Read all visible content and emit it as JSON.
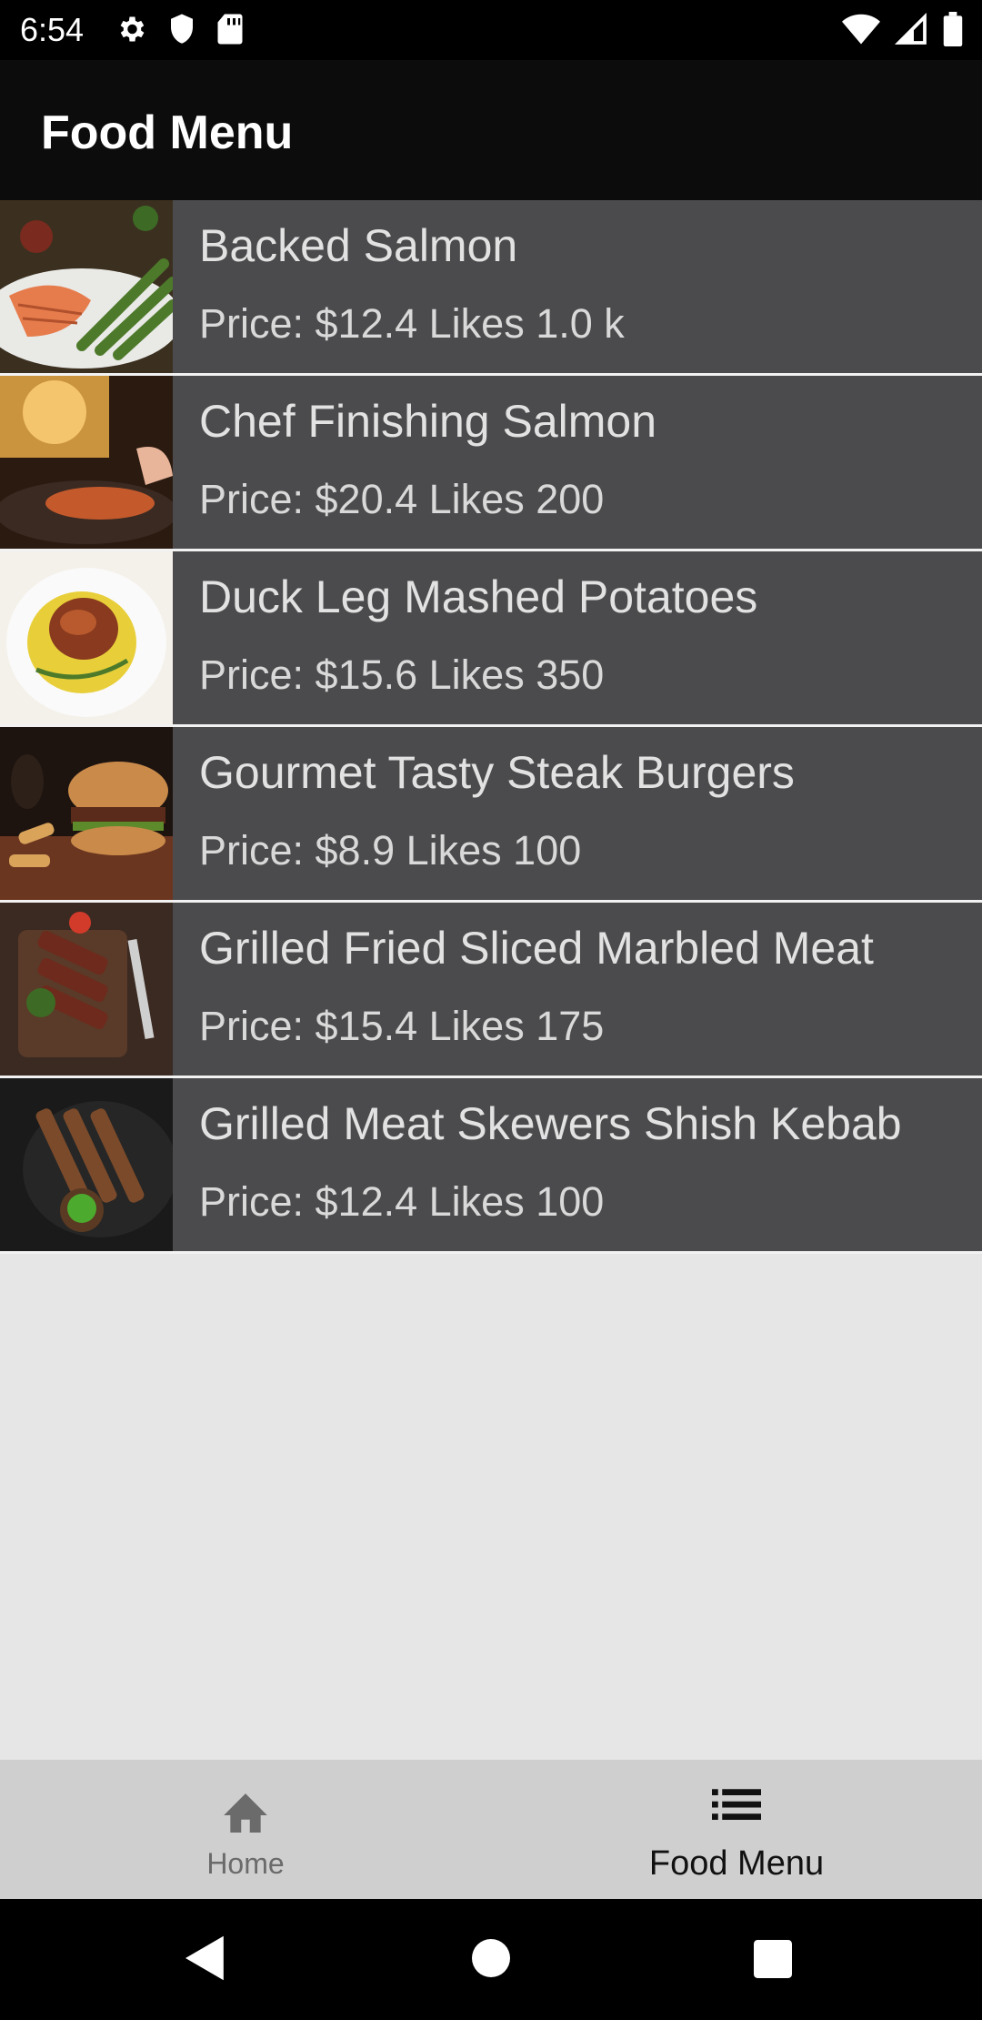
{
  "status_bar": {
    "time": "6:54",
    "left_icons": [
      "gear-icon",
      "shield-icon",
      "sd-card-icon"
    ],
    "right_icons": [
      "wifi-icon",
      "signal-icon",
      "battery-icon"
    ]
  },
  "app_bar": {
    "title": "Food Menu"
  },
  "menu": {
    "items": [
      {
        "name": "Backed Salmon",
        "meta": "Price: $12.4 Likes 1.0 k"
      },
      {
        "name": "Chef Finishing Salmon",
        "meta": "Price: $20.4 Likes 200"
      },
      {
        "name": "Duck Leg Mashed Potatoes",
        "meta": "Price: $15.6 Likes 350"
      },
      {
        "name": "Gourmet Tasty Steak Burgers",
        "meta": "Price: $8.9 Likes 100"
      },
      {
        "name": "Grilled Fried Sliced Marbled Meat",
        "meta": "Price: $15.4 Likes 175"
      },
      {
        "name": "Grilled Meat Skewers Shish Kebab",
        "meta": "Price: $12.4 Likes 100"
      }
    ]
  },
  "bottom_nav": {
    "tabs": [
      {
        "label": "Home",
        "icon": "home-icon",
        "selected": false
      },
      {
        "label": "Food Menu",
        "icon": "list-icon",
        "selected": true
      }
    ]
  },
  "system_nav": {
    "buttons": [
      "back-icon",
      "home-circle-icon",
      "recents-icon"
    ]
  },
  "colors": {
    "status_bar": "#000000",
    "app_bar": "#0c0c0c",
    "list_item": "#4b4b4d",
    "background": "#e6e6e6",
    "bottom_nav": "#cfcfcf"
  }
}
